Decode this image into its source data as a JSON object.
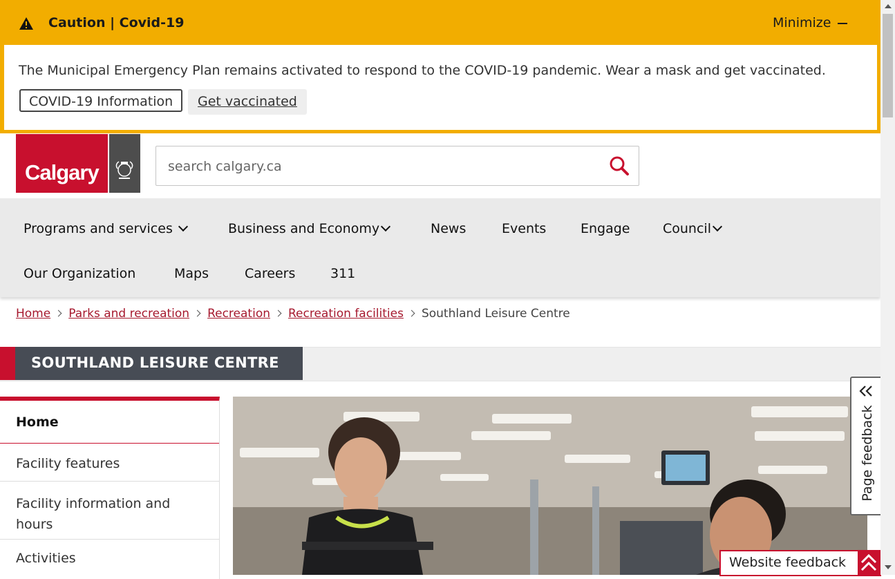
{
  "alert": {
    "title": "Caution | Covid-19",
    "minimize_label": "Minimize",
    "message": "The Municipal Emergency Plan remains activated to respond to the COVID-19 pandemic. Wear a mask and get vaccinated.",
    "buttons": [
      "COVID-19 Information",
      "Get vaccinated"
    ],
    "icon": "warning-icon",
    "color": "#f2ad00"
  },
  "header": {
    "logo_text": "Calgary",
    "brand_color": "#c8102e",
    "search_placeholder": "search calgary.ca"
  },
  "nav": {
    "items": [
      {
        "label": "Programs and services"
      },
      {
        "label": "Business and Economy"
      },
      {
        "label": "News"
      },
      {
        "label": "Events"
      },
      {
        "label": "Engage"
      },
      {
        "label": "Council"
      },
      {
        "label": "Our Organization"
      },
      {
        "label": "Maps"
      },
      {
        "label": "Careers"
      },
      {
        "label": "311"
      }
    ]
  },
  "breadcrumb": {
    "links": [
      "Home",
      "Parks and recreation",
      "Recreation",
      "Recreation facilities"
    ],
    "current": "Southland Leisure Centre"
  },
  "page": {
    "title": "SOUTHLAND LEISURE CENTRE"
  },
  "sidenav": {
    "items": [
      "Home",
      "Facility features",
      "Facility information and hours",
      "Activities"
    ]
  },
  "feedback": {
    "page_feedback": "Page feedback",
    "website_feedback": "Website feedback"
  }
}
